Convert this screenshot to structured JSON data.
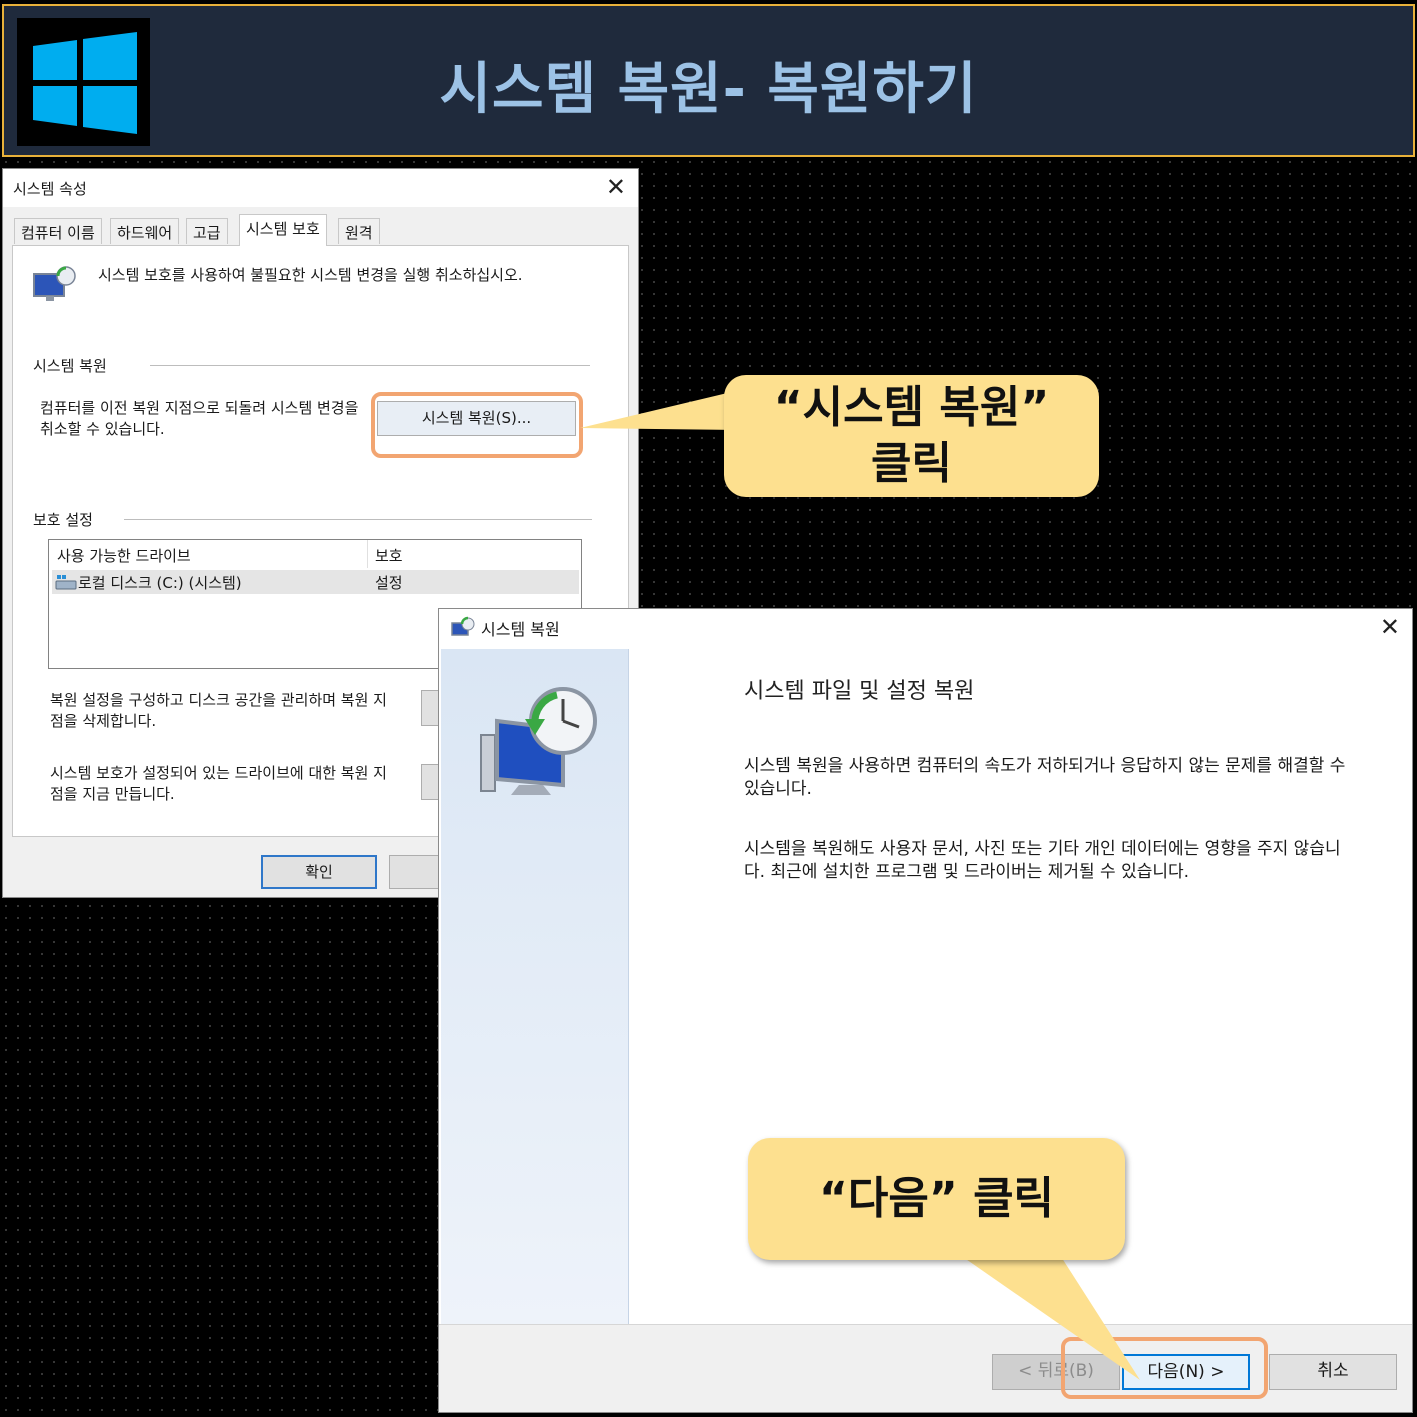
{
  "header": {
    "title": "시스템 복원- 복원하기",
    "logo_icon": "windows-logo-icon",
    "accent_color": "#e8b13a",
    "logo_color": "#00adef"
  },
  "props_dialog": {
    "title": "시스템 속성",
    "close_label": "✕",
    "tabs": [
      "컴퓨터 이름",
      "하드웨어",
      "고급",
      "시스템 보호",
      "원격"
    ],
    "active_tab": "시스템 보호",
    "intro_text": "시스템 보호를 사용하여 불필요한 시스템 변경을 실행 취소하십시오.",
    "restore_group_label": "시스템 복원",
    "restore_desc": "컴퓨터를 이전 복원 지점으로 되돌려 시스템 변경을 취소할 수 있습니다.",
    "restore_button": "시스템 복원(S)...",
    "protection_group_label": "보호 설정",
    "table": {
      "headers": [
        "사용 가능한 드라이브",
        "보호"
      ],
      "rows": [
        {
          "drive": "로컬 디스크 (C:) (시스템)",
          "protection": "설정"
        }
      ]
    },
    "configure_desc": "복원 설정을 구성하고 디스크 공간을 관리하며 복원 지점을 삭제합니다.",
    "create_desc": "시스템 보호가 설정되어 있는 드라이브에 대한 복원 지점을 지금 만듭니다.",
    "ok_button": "확인"
  },
  "callouts": {
    "restore_click": "“시스템 복원” 클릭",
    "next_click": "“다음” 클릭",
    "color": "#fde08f",
    "highlight_color": "#f2a571"
  },
  "wizard": {
    "title": "시스템 복원",
    "close_label": "✕",
    "heading": "시스템 파일 및 설정 복원",
    "para1": "시스템 복원을 사용하면 컴퓨터의 속도가 저하되거나 응답하지 않는 문제를 해결할 수 있습니다.",
    "para2": "시스템을 복원해도 사용자 문서, 사진 또는 기타 개인 데이터에는 영향을 주지 않습니다. 최근에 설치한 프로그램 및 드라이버는 제거될 수 있습니다.",
    "back_button": "< 뒤로(B)",
    "next_button": "다음(N) >",
    "cancel_button": "취소"
  }
}
